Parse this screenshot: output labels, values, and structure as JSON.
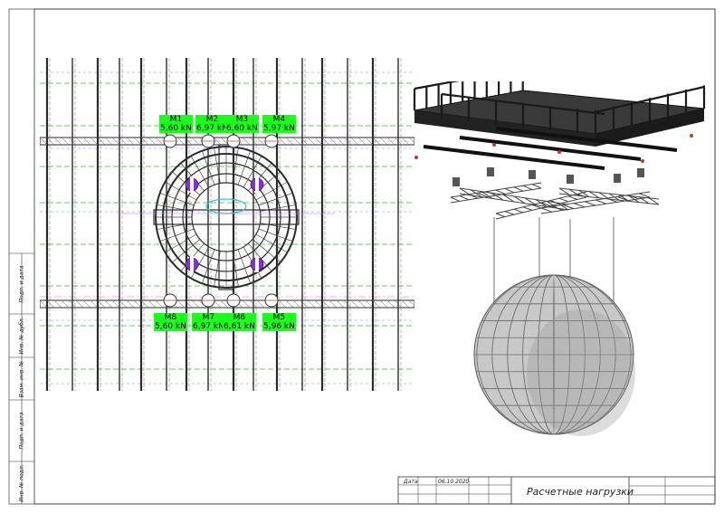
{
  "sidebar": {
    "fields": [
      {
        "label": "Подп. и дата"
      },
      {
        "label": "Инв. № дубл."
      },
      {
        "label": "Взам. инв. №"
      },
      {
        "label": "Подп. и дата"
      },
      {
        "label": "Инв. № подл."
      }
    ]
  },
  "title_block": {
    "date_label": "Дата",
    "date_value": "06.10.2020",
    "sheet_title": "Расчетные нагрузки"
  },
  "loads": [
    {
      "name": "M1",
      "value": "5,60 kN"
    },
    {
      "name": "M2",
      "value": "6,97 kN"
    },
    {
      "name": "M3",
      "value": "6,60 kN"
    },
    {
      "name": "M4",
      "value": "5,97 kN"
    },
    {
      "name": "M8",
      "value": "5,60 kN"
    },
    {
      "name": "M7",
      "value": "6,97 kN"
    },
    {
      "name": "M6",
      "value": "6,61 kN"
    },
    {
      "name": "M5",
      "value": "5,96 kN"
    }
  ],
  "colors": {
    "tag_green": "#19ff19",
    "truss": "#2b2b2b",
    "grid_green": "#3cb43c",
    "grid_blue": "#6c8cff",
    "grid_magenta": "#d06cd0",
    "hoist_purple": "#8a2be2",
    "sphere": "#c8c8c8"
  }
}
